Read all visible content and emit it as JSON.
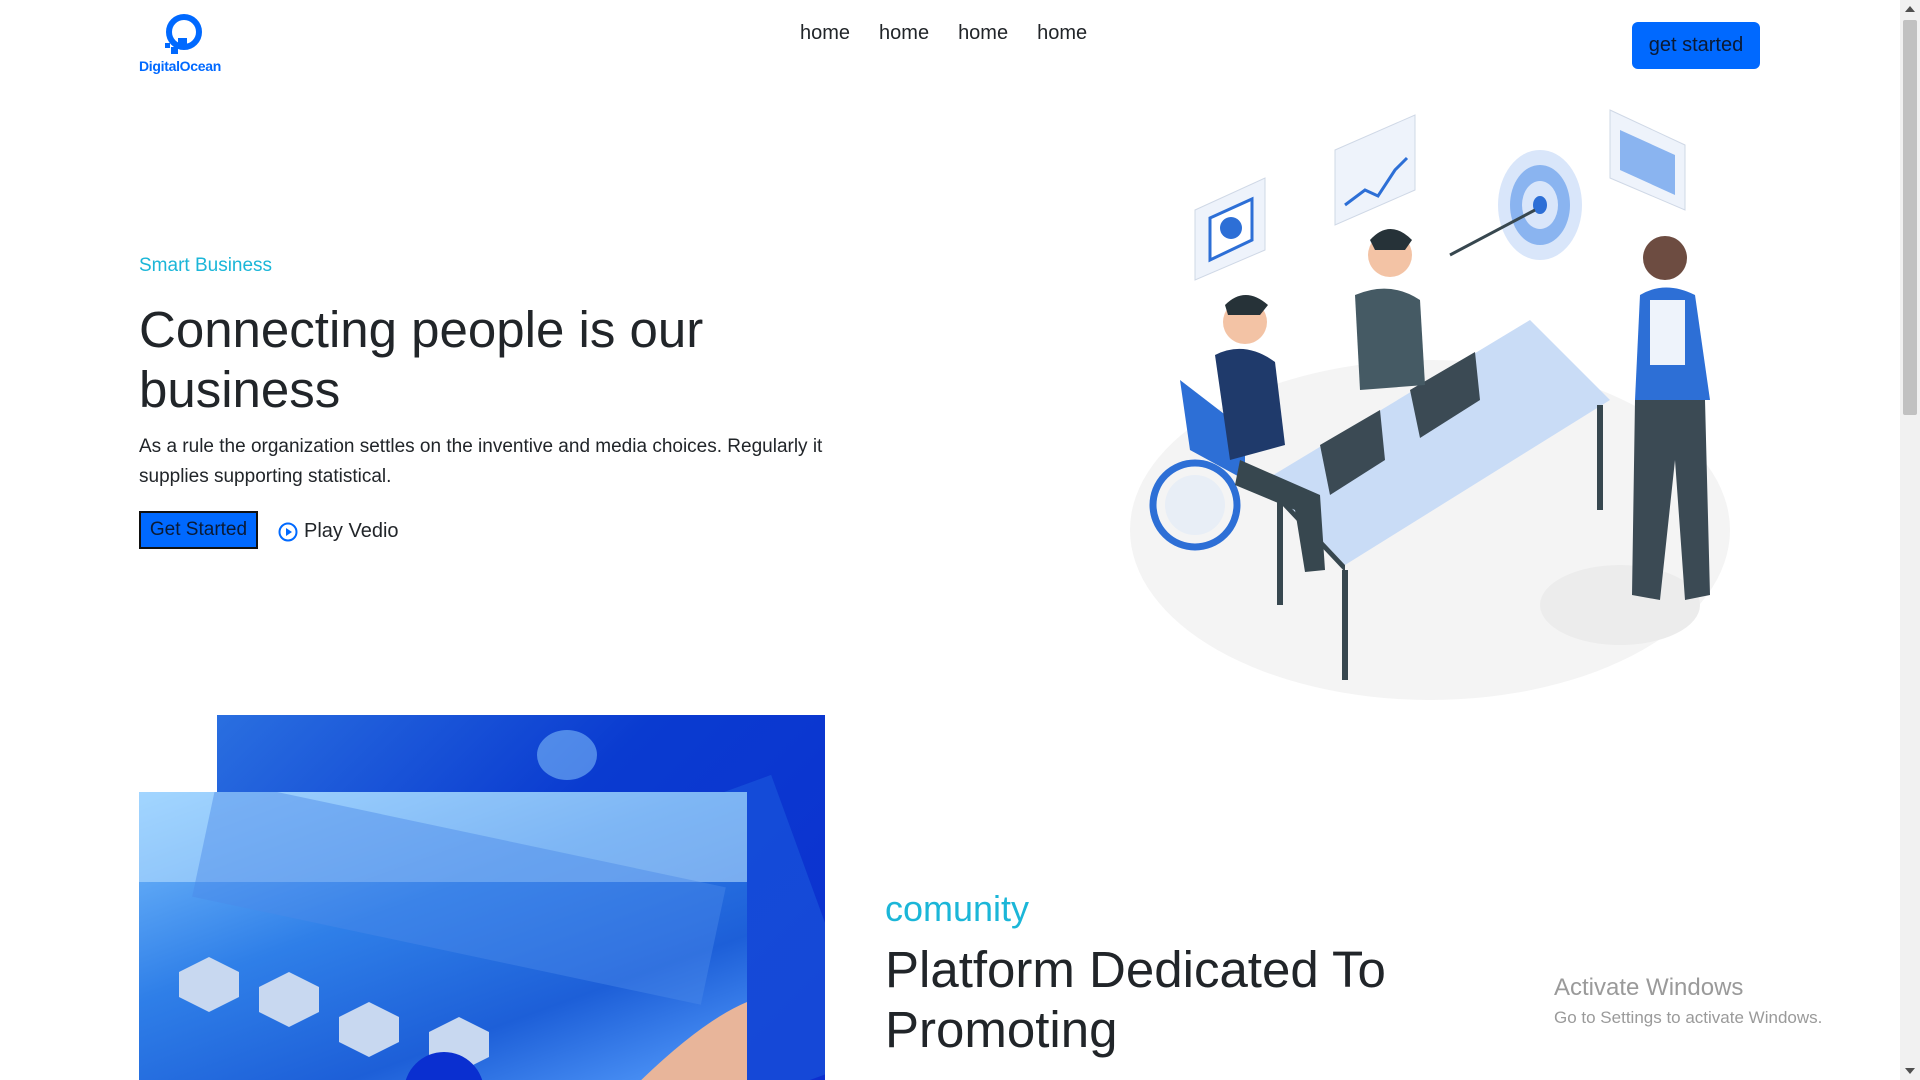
{
  "header": {
    "logo_text": "DigitalOcean",
    "nav": [
      "home",
      "home",
      "home",
      "home"
    ],
    "cta_label": "get started"
  },
  "hero": {
    "eyebrow": "Smart Business",
    "title": "Connecting people is our business",
    "description": "As a rule the organization settles on the inventive and media choices. Regularly it supplies supporting statistical.",
    "primary_button": "Get Started",
    "play_label": "Play Vedio"
  },
  "community": {
    "eyebrow": "comunity",
    "title": "Platform Dedicated To Promoting"
  },
  "watermark": {
    "title": "Activate Windows",
    "subtitle": "Go to Settings to activate Windows."
  },
  "colors": {
    "brand_blue": "#0069ff",
    "accent_cyan": "#1bb6d8",
    "text_dark": "#212529"
  },
  "icons": {
    "logo": "digitalocean-logo",
    "play": "play-circle-icon"
  }
}
